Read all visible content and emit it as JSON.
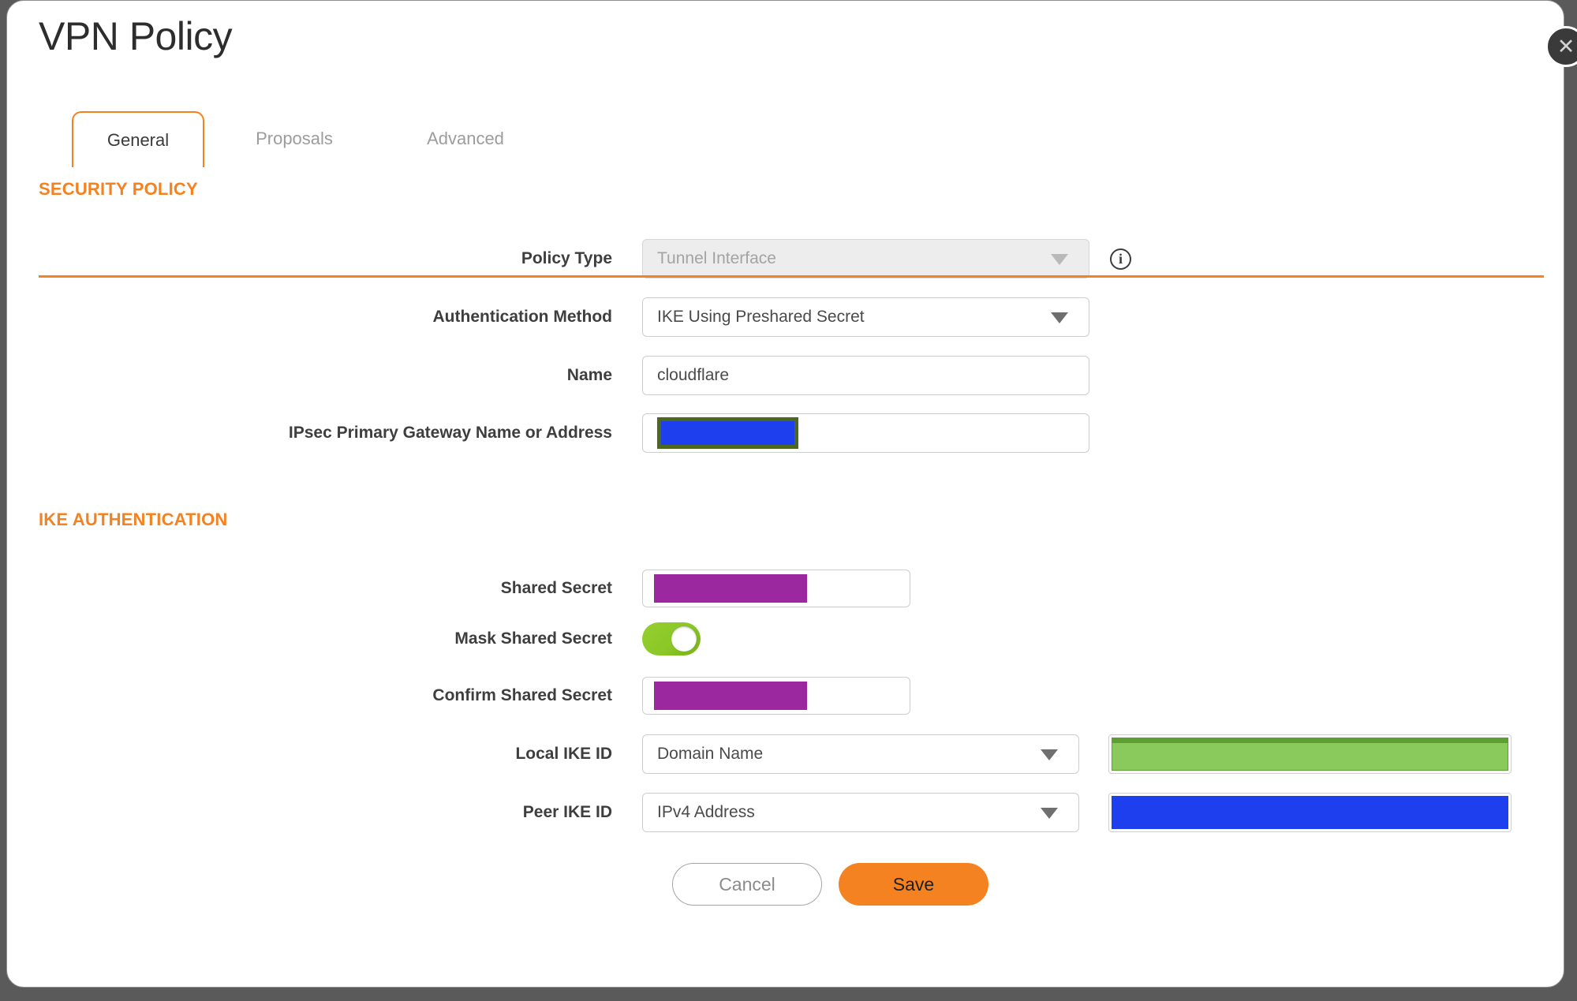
{
  "dialog": {
    "title": "VPN Policy",
    "close_icon": "✕"
  },
  "tabs": [
    {
      "label": "General",
      "active": true
    },
    {
      "label": "Proposals",
      "active": false
    },
    {
      "label": "Advanced",
      "active": false
    }
  ],
  "sections": {
    "security_policy": "SECURITY POLICY",
    "ike_authentication": "IKE AUTHENTICATION"
  },
  "fields": {
    "policy_type": {
      "label": "Policy Type",
      "value": "Tunnel Interface",
      "disabled": true,
      "info_icon": "i"
    },
    "auth_method": {
      "label": "Authentication Method",
      "value": "IKE Using Preshared Secret"
    },
    "name": {
      "label": "Name",
      "value": "cloudflare"
    },
    "gateway": {
      "label": "IPsec Primary Gateway Name or Address",
      "value_redacted": true
    },
    "shared_secret": {
      "label": "Shared Secret",
      "value_redacted": true
    },
    "mask_shared_secret": {
      "label": "Mask Shared Secret",
      "state": "on"
    },
    "confirm_shared_secret": {
      "label": "Confirm Shared Secret",
      "value_redacted": true
    },
    "local_ike_id": {
      "label": "Local IKE ID",
      "value": "Domain Name",
      "value_redacted": true
    },
    "peer_ike_id": {
      "label": "Peer IKE ID",
      "value": "IPv4 Address",
      "value_redacted": true
    }
  },
  "buttons": {
    "cancel": "Cancel",
    "save": "Save"
  },
  "colors": {
    "accent": "#f58220",
    "toggle_green": "#8bc727",
    "redact_purple": "#9c28a0",
    "redact_blue": "#1d3fee",
    "redact_green": "#8ac95c",
    "redact_green_dark": "#5f9e33",
    "gateway_border": "#4c681f"
  }
}
